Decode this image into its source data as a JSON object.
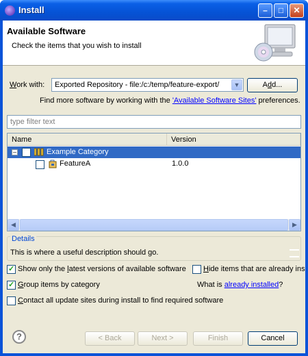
{
  "window": {
    "title": "Install"
  },
  "header": {
    "title": "Available Software",
    "subtitle": "Check the items that you wish to install"
  },
  "work_with": {
    "label_w": "W",
    "label_rest": "ork with:",
    "value": "Exported Repository - file:/c:/temp/feature-export/",
    "add_prefix": "A",
    "add_u": "d",
    "add_suffix": "d..."
  },
  "sites": {
    "prefix": "Find more software by working with the ",
    "link": "'Available Software Sites'",
    "suffix": " preferences."
  },
  "filter": {
    "placeholder": "type filter text"
  },
  "table": {
    "columns": [
      "Name",
      "Version"
    ],
    "rows": [
      {
        "name": "Example Category",
        "version": "",
        "selected": true,
        "checked": false
      },
      {
        "name": "FeatureA",
        "version": "1.0.0",
        "selected": false,
        "checked": false
      }
    ]
  },
  "details": {
    "legend": "Details",
    "text": "This is where a useful description should go."
  },
  "options": {
    "latest_a": "Show only the ",
    "latest_u": "l",
    "latest_b": "atest versions of available software",
    "latest_checked": true,
    "hide_u": "H",
    "hide_b": "ide items that are already ins",
    "hide_checked": false,
    "group_u": "G",
    "group_b": "roup items by category",
    "group_checked": true,
    "installed_prefix": "What is ",
    "installed_link": "already installed",
    "installed_suffix": "?",
    "contact_u": "C",
    "contact_b": "ontact all update sites during install to find required software",
    "contact_checked": false
  },
  "footer": {
    "back": "< Back",
    "next": "Next >",
    "finish": "Finish",
    "cancel": "Cancel"
  },
  "icons": {
    "app": "eclipse-icon",
    "help": "help-icon",
    "banner": "computer-cd-icon"
  }
}
